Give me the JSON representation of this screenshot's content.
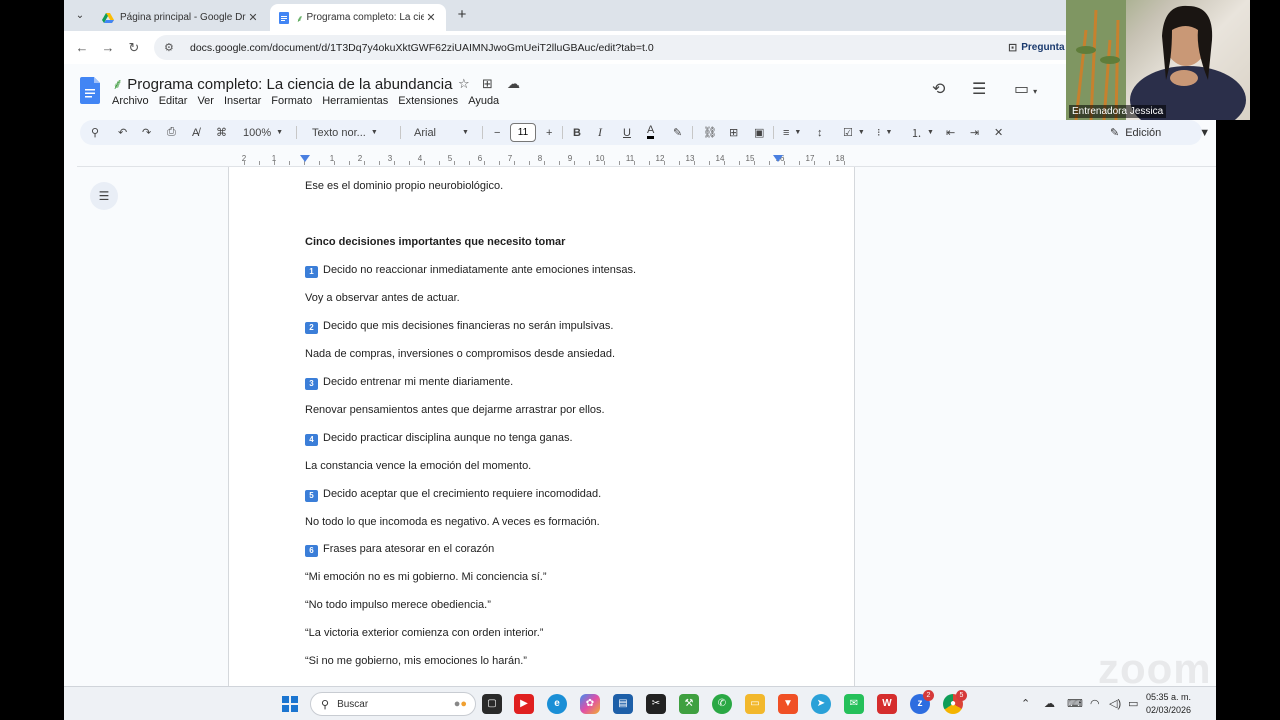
{
  "browser": {
    "tabs": [
      {
        "title": "Página principal - Google Drive",
        "active": false
      },
      {
        "title": "Programa completo: La cien",
        "active": true
      }
    ],
    "url": "docs.google.com/document/d/1T3Dq7y4okuXktGWF62ziUAIMNJwoGmUeiT2lluGBAuc/edit?tab=t.0",
    "ask_label": "Pregunta"
  },
  "doc": {
    "title": "Programa completo: La ciencia de la abundancia",
    "menus": [
      "Archivo",
      "Editar",
      "Ver",
      "Insertar",
      "Formato",
      "Herramientas",
      "Extensiones",
      "Ayuda"
    ]
  },
  "toolbar": {
    "zoom": "100%",
    "style": "Texto nor...",
    "font": "Arial",
    "font_size": "11",
    "mode": "Edición"
  },
  "ruler": [
    "2",
    "1",
    "1",
    "2",
    "3",
    "4",
    "5",
    "6",
    "7",
    "8",
    "9",
    "10",
    "11",
    "12",
    "13",
    "14",
    "15",
    "16",
    "17",
    "18"
  ],
  "content": {
    "lines": [
      {
        "text": "Ese es el dominio propio neurobiológico.",
        "bold": false,
        "key": ""
      },
      {
        "text": "Cinco decisiones importantes que necesito tomar",
        "bold": true,
        "key": ""
      },
      {
        "text": "Decido no reaccionar inmediatamente ante emociones intensas.",
        "bold": false,
        "key": "1"
      },
      {
        "text": "Voy a observar antes de actuar.",
        "bold": false,
        "key": ""
      },
      {
        "text": "Decido que mis decisiones financieras no serán impulsivas.",
        "bold": false,
        "key": "2"
      },
      {
        "text": "Nada de compras, inversiones o compromisos desde ansiedad.",
        "bold": false,
        "key": ""
      },
      {
        "text": "Decido entrenar mi mente diariamente.",
        "bold": false,
        "key": "3"
      },
      {
        "text": "Renovar pensamientos antes que dejarme arrastrar por ellos.",
        "bold": false,
        "key": ""
      },
      {
        "text": "Decido practicar disciplina aunque no tenga ganas.",
        "bold": false,
        "key": "4"
      },
      {
        "text": "La constancia vence la emoción del momento.",
        "bold": false,
        "key": ""
      },
      {
        "text": "Decido aceptar que el crecimiento requiere incomodidad.",
        "bold": false,
        "key": "5"
      },
      {
        "text": "No todo lo que incomoda es negativo. A veces es formación.",
        "bold": false,
        "key": ""
      },
      {
        "text": "Frases para atesorar en el corazón",
        "bold": false,
        "key": "6"
      },
      {
        "text": "“Mi emoción no es mi gobierno. Mi conciencia sí.”",
        "bold": false,
        "key": ""
      },
      {
        "text": "“No todo impulso merece obediencia.”",
        "bold": false,
        "key": ""
      },
      {
        "text": "“La victoria exterior comienza con orden interior.”",
        "bold": false,
        "key": ""
      },
      {
        "text": "“Si no me gobierno, mis emociones lo harán.”",
        "bold": false,
        "key": ""
      }
    ]
  },
  "video": {
    "participant": "Entrenadora Jessica",
    "watermark": "zoom"
  },
  "taskbar": {
    "search_placeholder": "Buscar",
    "time": "05:35 a. m.",
    "date": "02/03/2026",
    "badges": [
      "2",
      "5"
    ]
  }
}
